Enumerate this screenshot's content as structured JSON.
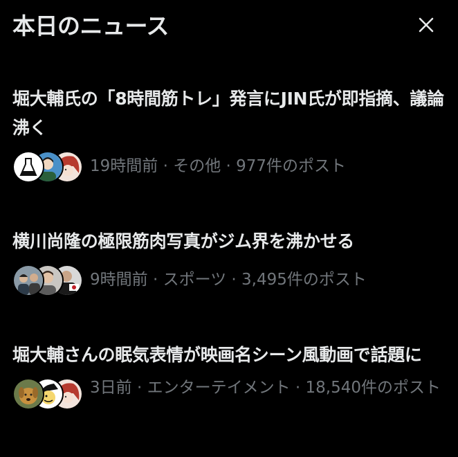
{
  "header": {
    "title": "本日のニュース",
    "close_icon": "close-icon"
  },
  "news": [
    {
      "title": "堀大輔氏の「8時間筋トレ」発言にJIN氏が即指摘、議論沸く",
      "meta": "19時間前 · その他 · 977件のポスト",
      "avatars": [
        "flask-avatar",
        "person-avatar",
        "anime-avatar"
      ]
    },
    {
      "title": "横川尚隆の極限筋肉写真がジム界を沸かせる",
      "meta": "9時間前 · スポーツ · 3,495件のポスト",
      "avatars": [
        "people-avatar",
        "person-avatar",
        "flag-avatar"
      ]
    },
    {
      "title": "堀大輔さんの眠気表情が映画名シーン風動画で話題に",
      "meta": "3日前 · エンターテイメント · 18,540件のポスト",
      "avatars": [
        "dog-avatar",
        "cartoon-avatar",
        "anime-avatar"
      ]
    }
  ],
  "colors": {
    "background": "#000000",
    "text_primary": "#e7e9ea",
    "text_secondary": "#71767b"
  }
}
